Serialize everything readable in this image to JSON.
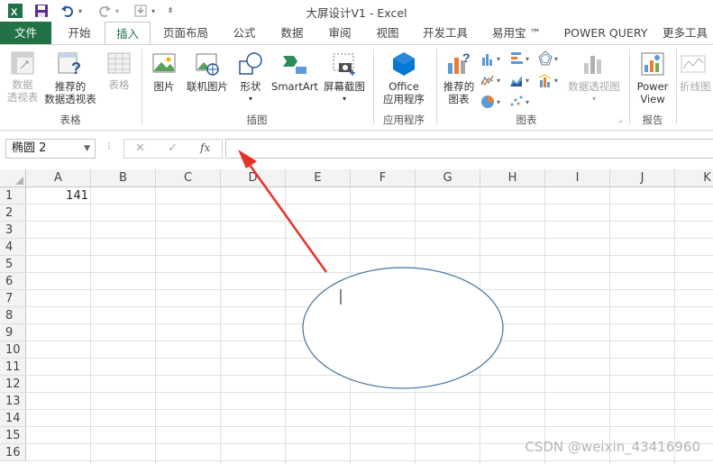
{
  "title_bar": {
    "title": "大屏设计V1 - Excel",
    "icons": [
      "excel-logo-icon",
      "save-icon",
      "undo-icon",
      "redo-icon",
      "customize-qat-icon"
    ]
  },
  "tabs": [
    {
      "label": "文件"
    },
    {
      "label": "开始"
    },
    {
      "label": "插入"
    },
    {
      "label": "页面布局"
    },
    {
      "label": "公式"
    },
    {
      "label": "数据"
    },
    {
      "label": "审阅"
    },
    {
      "label": "视图"
    },
    {
      "label": "开发工具"
    },
    {
      "label": "易用宝 ™"
    },
    {
      "label": "POWER QUERY"
    },
    {
      "label": "更多工具"
    }
  ],
  "ribbon": {
    "buttons": {
      "pivot_table": {
        "line1": "数据",
        "line2": "透视表"
      },
      "recommended_pivot": {
        "line1": "推荐的",
        "line2": "数据透视表"
      },
      "table": {
        "line1": "表格",
        "line2": ""
      },
      "pictures": {
        "line1": "图片"
      },
      "online_pictures": {
        "line1": "联机图片"
      },
      "shapes": {
        "line1": "形状"
      },
      "smartart": {
        "line1": "SmartArt"
      },
      "screenshot": {
        "line1": "屏幕截图"
      },
      "office_apps": {
        "line1": "Office",
        "line2": "应用程序"
      },
      "recommended_charts": {
        "line1": "推荐的",
        "line2": "图表"
      },
      "pivot_chart": {
        "line1": "数据透视图"
      },
      "power_view": {
        "line1": "Power",
        "line2": "View"
      },
      "sparkline": {
        "line1": "折线图"
      }
    },
    "groups": {
      "tables": "表格",
      "illustrations": "插图",
      "apps": "应用程序",
      "charts": "图表",
      "reports": "报告"
    }
  },
  "formula_bar": {
    "name_box": "椭圆 2",
    "cancel": "✕",
    "enter": "✓",
    "fx": "fx",
    "value": ""
  },
  "sheet": {
    "columns": [
      "A",
      "B",
      "C",
      "D",
      "E",
      "F",
      "G",
      "H",
      "I",
      "J",
      "K"
    ],
    "rows": [
      "1",
      "2",
      "3",
      "4",
      "5",
      "6",
      "7",
      "8",
      "9",
      "10",
      "11",
      "12",
      "13",
      "14",
      "15",
      "16"
    ],
    "cells": {
      "A1": "141"
    }
  },
  "watermark": "CSDN @weixin_43416960",
  "colors": {
    "accent": "#217346",
    "arrow": "#e8312a",
    "shape_outline": "#41719c"
  }
}
